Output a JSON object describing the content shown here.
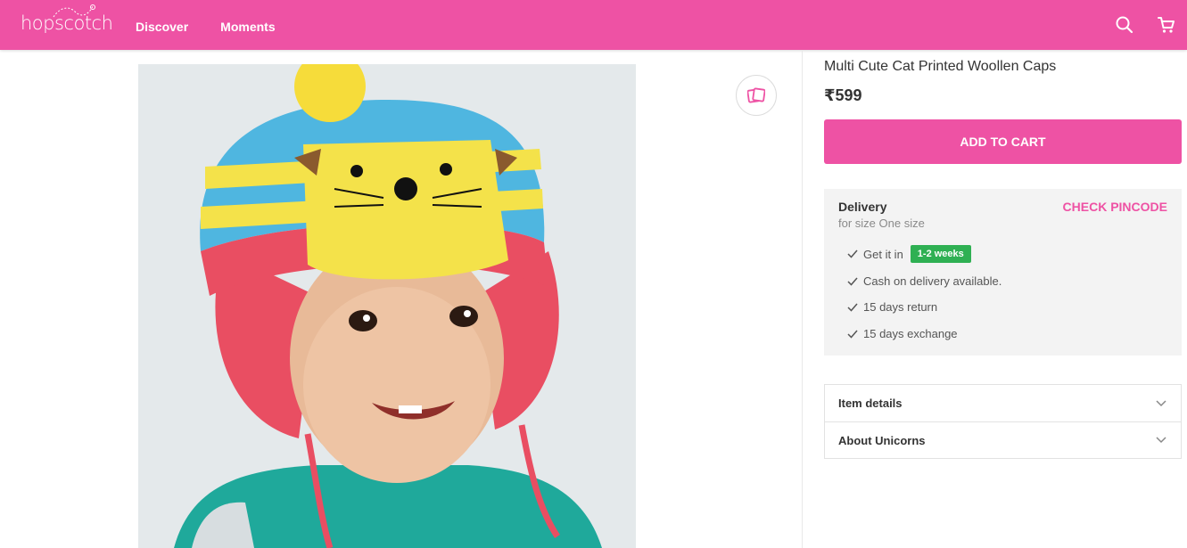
{
  "header": {
    "logo": "hopscotch",
    "nav": [
      "Discover",
      "Moments"
    ],
    "icons": [
      "search-icon",
      "cart-icon"
    ]
  },
  "product": {
    "title": "Multi Cute Cat Printed Woollen Caps",
    "price": "₹599",
    "add_to_cart": "ADD TO CART",
    "image_alt_icon": "wishlist-icon"
  },
  "delivery": {
    "title": "Delivery",
    "size_note": "for size One size",
    "check_pincode": "CHECK PINCODE",
    "get_it_in": "Get it in",
    "eta_badge": "1-2 weeks",
    "features": [
      "Cash on delivery available.",
      "15 days return",
      "15 days exchange"
    ]
  },
  "accordion": {
    "items": [
      "Item details",
      "About Unicorns"
    ]
  },
  "colors": {
    "brand": "#ee52a4",
    "badge": "#2fb053"
  }
}
